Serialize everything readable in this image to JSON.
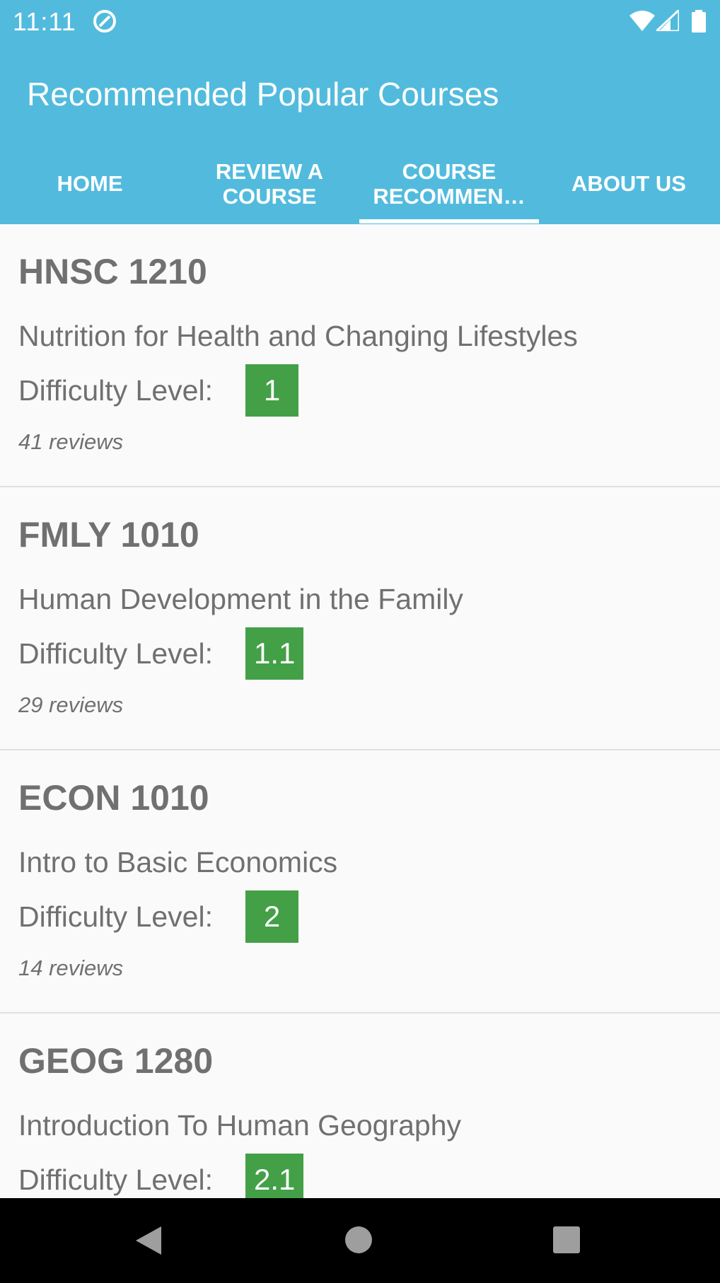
{
  "status_bar": {
    "time": "11:11",
    "icons": [
      "app-notification-icon",
      "wifi-icon",
      "signal-icon",
      "battery-icon"
    ]
  },
  "app_bar": {
    "title": "Recommended Popular Courses",
    "color": "#52bbdd"
  },
  "tabs": [
    {
      "label": "HOME"
    },
    {
      "label": "REVIEW A\nCOURSE"
    },
    {
      "label": "COURSE\nRECOMMEN…"
    },
    {
      "label": "ABOUT US"
    }
  ],
  "selected_tab": "COURSE\nRECOMMEN…",
  "difficulty_label": "Difficulty Level:",
  "courses": [
    {
      "code": "HNSC 1210",
      "name": "Nutrition for Health and Changing Lifestyles",
      "difficulty": "1",
      "reviews": "41 reviews"
    },
    {
      "code": "FMLY 1010",
      "name": "Human Development in the Family",
      "difficulty": "1.1",
      "reviews": "29 reviews"
    },
    {
      "code": "ECON 1010",
      "name": "Intro to Basic Economics",
      "difficulty": "2",
      "reviews": "14 reviews"
    },
    {
      "code": "GEOG 1280",
      "name": "Introduction To Human Geography",
      "difficulty": "2.1",
      "reviews": ""
    }
  ],
  "colors": {
    "primary": "#52bbdd",
    "difficulty_badge": "#43a047",
    "text": "#707070"
  },
  "nav_bar": {
    "buttons": [
      "back-icon",
      "home-icon",
      "recents-icon"
    ]
  }
}
